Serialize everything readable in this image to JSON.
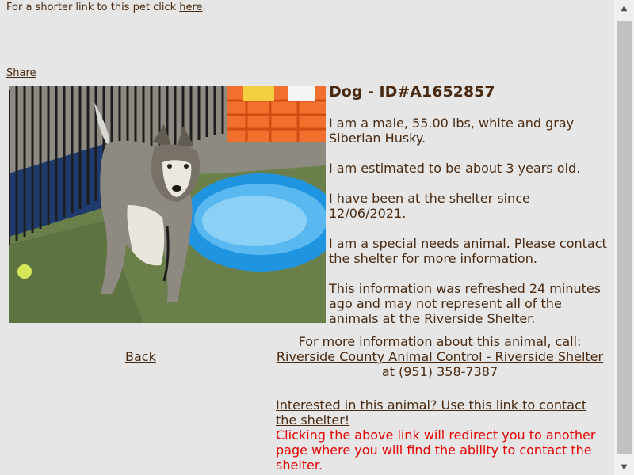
{
  "top": {
    "prefix": "For a shorter link to this pet click ",
    "link": "here",
    "suffix": "."
  },
  "share": "Share",
  "pet": {
    "title": "Dog - ID#A1652857",
    "description": "I am a male, 55.00 lbs, white and gray Siberian Husky.",
    "age": "I am estimated to be about 3 years old.",
    "shelter_since": "I have been at the shelter since 12/06/2021.",
    "special_needs": "I am a special needs animal. Please contact the shelter for more information.",
    "refresh_note": "This information was refreshed 24 minutes ago and may not represent all of the animals at the Riverside Shelter."
  },
  "back": "Back",
  "more_info": {
    "prefix": "For more information about this animal, call:",
    "shelter_link": "Riverside County Animal Control - Riverside Shelter",
    "phone": " at (951) 358-7387"
  },
  "contact": {
    "link": "Interested in this animal? Use this link to contact the shelter!",
    "note": "Clicking the above link will redirect you to another page where you will find the ability to contact the shelter."
  }
}
